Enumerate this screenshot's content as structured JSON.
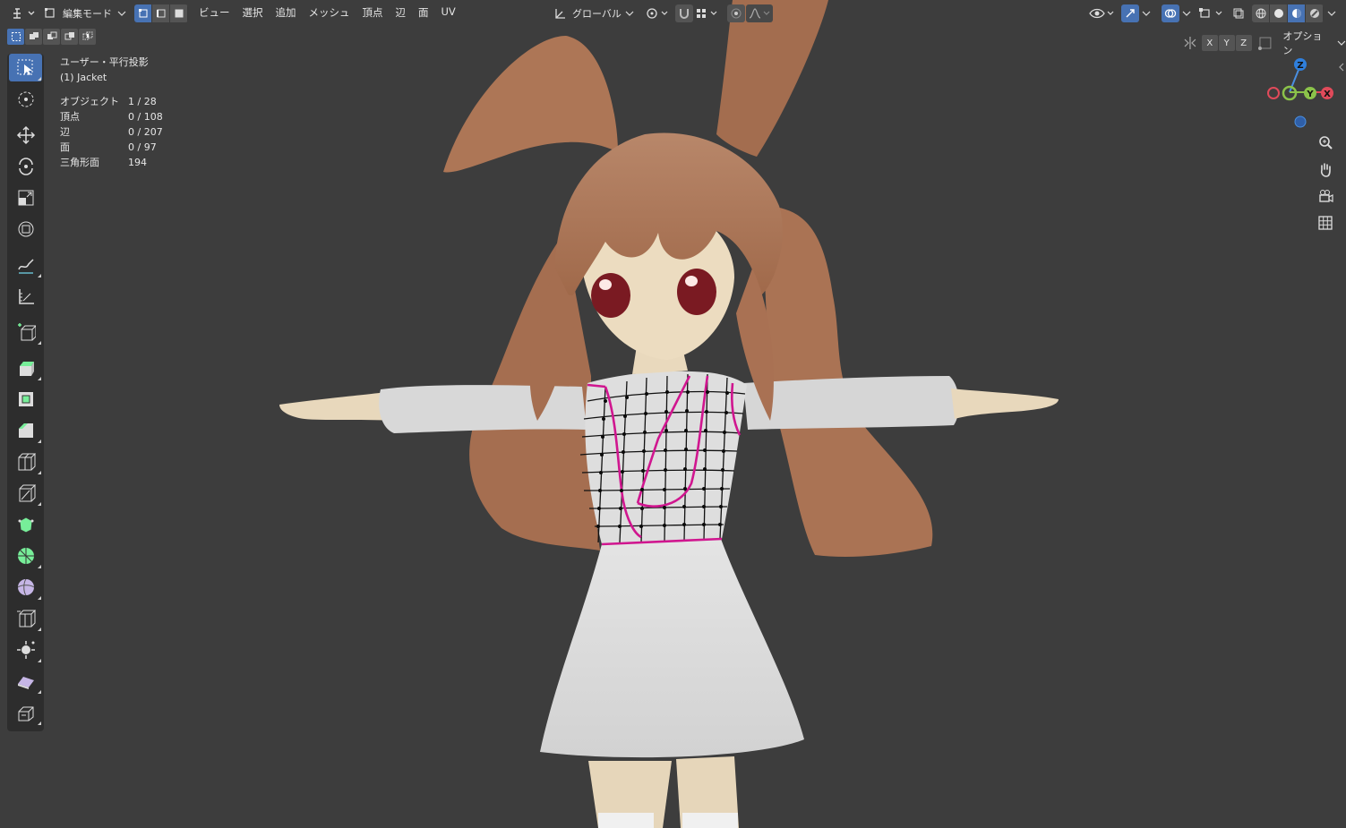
{
  "header": {
    "mode_label": "編集モード",
    "menus": [
      "ビュー",
      "選択",
      "追加",
      "メッシュ",
      "頂点",
      "辺",
      "面",
      "UV"
    ],
    "transform_orientation": "グローバル",
    "options_label": "オプション",
    "mirror_axes": [
      "X",
      "Y",
      "Z"
    ]
  },
  "overlay": {
    "view_name": "ユーザー・平行投影",
    "object_name": "(1) Jacket",
    "stats": [
      {
        "label": "オブジェクト",
        "value": "1 / 28"
      },
      {
        "label": "頂点",
        "value": "0 / 108"
      },
      {
        "label": "辺",
        "value": "0 / 207"
      },
      {
        "label": "面",
        "value": "0 / 97"
      },
      {
        "label": "三角形面",
        "value": "194"
      }
    ]
  },
  "gizmo": {
    "z_label": "Z",
    "y_label": "Y",
    "x_label": "X"
  },
  "toolbar": {
    "tools": [
      "select-box",
      "cursor",
      "move",
      "rotate",
      "scale",
      "transform",
      "annotate",
      "measure",
      "add-cube",
      "extrude-region",
      "inset-faces",
      "bevel",
      "loop-cut",
      "knife",
      "poly-build",
      "spin",
      "smooth",
      "edge-slide",
      "shrink-fatten",
      "shear",
      "rip-region"
    ]
  },
  "colors": {
    "viewport_bg": "#3d3d3d",
    "accent": "#4772b3",
    "seam": "#d0168f",
    "hair": "#b07c5c",
    "skin": "#ecdcc0",
    "shirt": "#dcdcdc"
  }
}
